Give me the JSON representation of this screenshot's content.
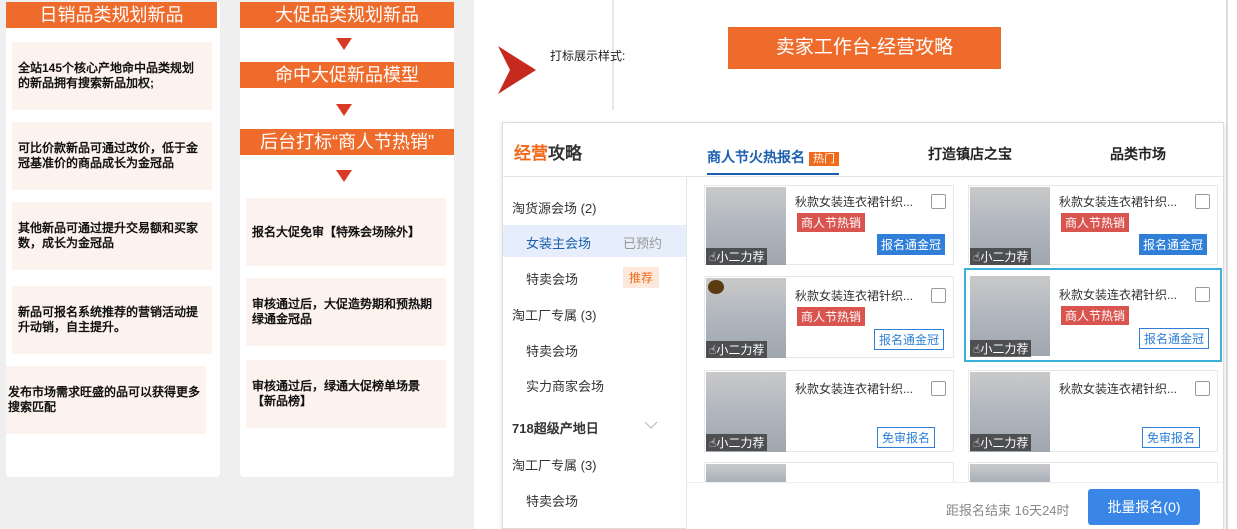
{
  "col1": {
    "header": "日销品类规划新品",
    "cards": [
      "全站145个核心产地命中品类规划的新品拥有搜索新品加权;",
      "可比价款新品可通过改价，低于金冠基准价的商品成长为金冠品",
      "其他新品可通过提升交易额和买家数，成长为金冠品",
      "新品可报名系统推荐的营销活动提升动销，自主提升。",
      "发布市场需求旺盛的品可以获得更多搜索匹配"
    ]
  },
  "col2": {
    "header": "大促品类规划新品",
    "step2": "命中大促新品模型",
    "step3": "后台打标“商人节热销”",
    "cards": [
      "报名大促免审【特殊会场除外】",
      "审核通过后，大促造势期和预热期绿通金冠品",
      "审核通过后，绿通大促榜单场景【新品榜】"
    ]
  },
  "right": {
    "label": "打标展示样式:",
    "banner": "卖家工作台-经营攻略"
  },
  "shot": {
    "logo_a": "经营",
    "logo_b": "攻略",
    "tabs": [
      "商人节火热报名",
      "打造镇店之宝",
      "品类市场"
    ],
    "hot_badge": "热门",
    "sidebar": [
      {
        "label": "淘货源会场 (2)",
        "tag": ""
      },
      {
        "label": "女装主会场",
        "tag": "已预约"
      },
      {
        "label": "特卖会场",
        "tag": "推荐"
      },
      {
        "label": "淘工厂专属 (3)",
        "tag": ""
      },
      {
        "label": "特卖会场",
        "tag": ""
      },
      {
        "label": "实力商家会场",
        "tag": ""
      },
      {
        "label": "718超级产地日",
        "tag": ""
      },
      {
        "label": "淘工厂专属 (3)",
        "tag": ""
      },
      {
        "label": "特卖会场",
        "tag": ""
      }
    ],
    "product_title": "秋款女装连衣裙针织...",
    "product_thumb_label": "小二力荐",
    "tag_hot": "商人节热销",
    "btn_gold": "报名通金冠",
    "btn_free": "免审报名",
    "countdown": "距报名结束 16天24时",
    "batch_btn": "批量报名(0)"
  },
  "colors": {
    "orange": "#ee6b2c",
    "blue": "#2f7fd8",
    "red": "#d9534f"
  }
}
